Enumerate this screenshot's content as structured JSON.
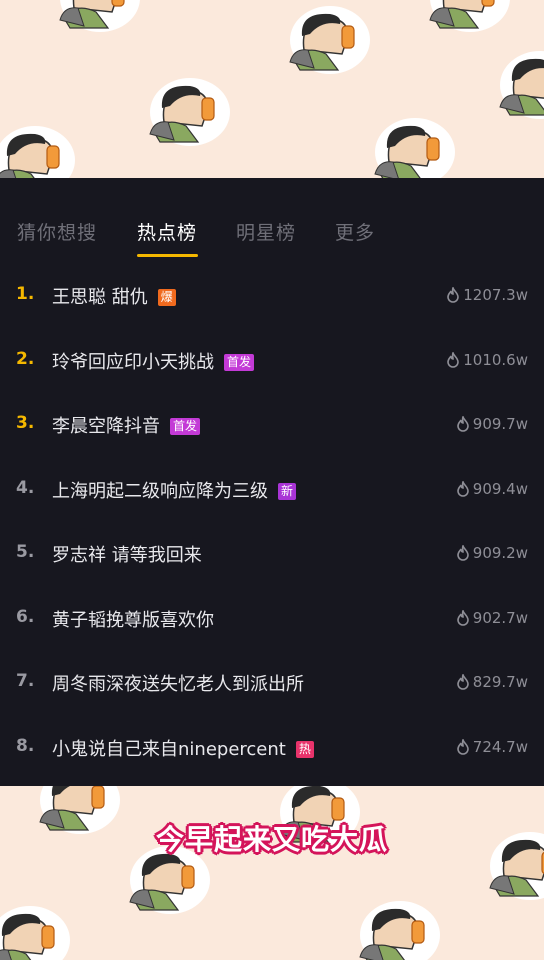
{
  "tabs": [
    {
      "label": "猜你想搜",
      "active": false
    },
    {
      "label": "热点榜",
      "active": true
    },
    {
      "label": "明星榜",
      "active": false
    },
    {
      "label": "更多",
      "active": false
    }
  ],
  "hot_list": [
    {
      "rank": "1.",
      "title": "王思聪 甜仇",
      "badge": "爆",
      "badge_color": "#f06a1e",
      "heat": "1207.3w"
    },
    {
      "rank": "2.",
      "title": "玲爷回应印小天挑战",
      "badge": "首发",
      "badge_color": "#c33ad6",
      "heat": "1010.6w"
    },
    {
      "rank": "3.",
      "title": "李晨空降抖音",
      "badge": "首发",
      "badge_color": "#c33ad6",
      "heat": "909.7w"
    },
    {
      "rank": "4.",
      "title": "上海明起二级响应降为三级",
      "badge": "新",
      "badge_color": "#a934d6",
      "heat": "909.4w"
    },
    {
      "rank": "5.",
      "title": "罗志祥 请等我回来",
      "badge": "",
      "badge_color": "",
      "heat": "909.2w"
    },
    {
      "rank": "6.",
      "title": "黄子韬挽尊版喜欢你",
      "badge": "",
      "badge_color": "",
      "heat": "902.7w"
    },
    {
      "rank": "7.",
      "title": "周冬雨深夜送失忆老人到派出所",
      "badge": "",
      "badge_color": "",
      "heat": "829.7w"
    },
    {
      "rank": "8.",
      "title": "小鬼说自己来自ninepercent",
      "badge": "热",
      "badge_color": "#e8336b",
      "heat": "724.7w"
    }
  ],
  "caption": "今早起来又吃大瓜",
  "icons": {
    "heat": "flame-icon",
    "sticker": "eating-melon-sticker"
  },
  "colors": {
    "accent": "#f5b800",
    "panel": "#17171f",
    "background": "#fbe9dc"
  }
}
